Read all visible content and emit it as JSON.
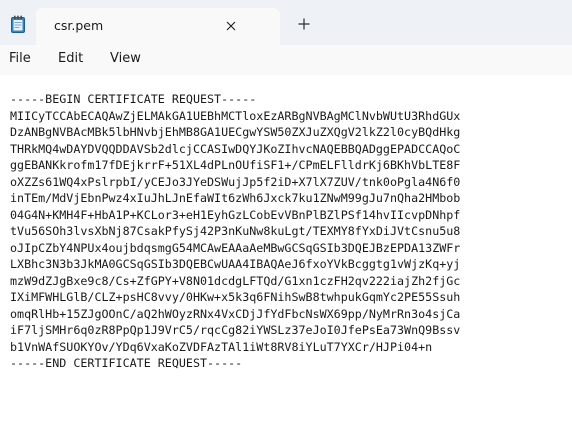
{
  "tab": {
    "title": "csr.pem",
    "close_glyph": "✕",
    "app_icon": "notepad-icon",
    "new_tab_glyph": "+"
  },
  "menu": {
    "file": "File",
    "edit": "Edit",
    "view": "View"
  },
  "document": {
    "lines": [
      "-----BEGIN CERTIFICATE REQUEST-----",
      "MIICyTCCAbECAQAwZjELMAkGA1UEBhMCTloxEzARBgNVBAgMClNvbWUtU3RhdGUx",
      "DzANBgNVBAcMBk5lbHNvbjEhMB8GA1UECgwYSW50ZXJuZXQgV2lkZ2l0cyBQdHkg",
      "THRkMQ4wDAYDVQQDDAVSb2dlcjCCASIwDQYJKoZIhvcNAQEBBQADggEPADCCAQoC",
      "ggEBANKkrofm17fDEjkrrF+51XL4dPLnOUfiSF1+/CPmELFlldrKj6BKhVbLTE8F",
      "oXZZs61WQ4xPslrpbI/yCEJo3JYeDSWujJp5f2iD+X7lX7ZUV/tnk0oPgla4N6f0",
      "inTEm/MdVjEbnPwz4xIuJhLJnEfaWIt6zWh6Jxck7ku1ZNwM99gJu7nQha2HMbob",
      "04G4N+KMH4F+HbA1P+KCLor3+eH1EyhGzLCobEvVBnPlBZlPSf14hvIIcvpDNhpf",
      "tVu56SOh3lvsXbNj87CsakPfySj42P3nKuNw8kuLgt/TEXMY8fYxDiJVtCsnu5u8",
      "oJIpCZbY4NPUx4oujbdqsmgG54MCAwEAAaAeMBwGCSqGSIb3DQEJBzEPDA13ZWFr",
      "LXBhc3N3b3JkMA0GCSqGSIb3DQEBCwUAA4IBAQAeJ6fxoYVkBcggtg1vWjzKq+yj",
      "mzW9dZJgBxe9c8/Cs+ZfGPY+V8N01dcdgLFTQd/G1xn1czFH2qv222iajZh2fjGc",
      "IXiMFWHLGlB/CLZ+psHC8vvy/0HKw+x5k3q6FNihSwB8twhpukGqmYc2PE55Ssuh",
      "omqRlHb+15ZJgOOnC/aQ2hWOyzRNx4VxCDjJfYdFbcNsWX69pp/NyMrRn3o4sjCa",
      "iF7ljSMHr6q0zR8PpQp1J9VrC5/rqcCg82iYWSLz37eJoI0JfePsEa73WnQ9Bssv",
      "b1VnWAfSUOKYOv/YDq6VxaKoZVDFAzTAl1iWt8RV8iYLuT7YXCr/HJPi04+n",
      "-----END CERTIFICATE REQUEST-----"
    ]
  }
}
